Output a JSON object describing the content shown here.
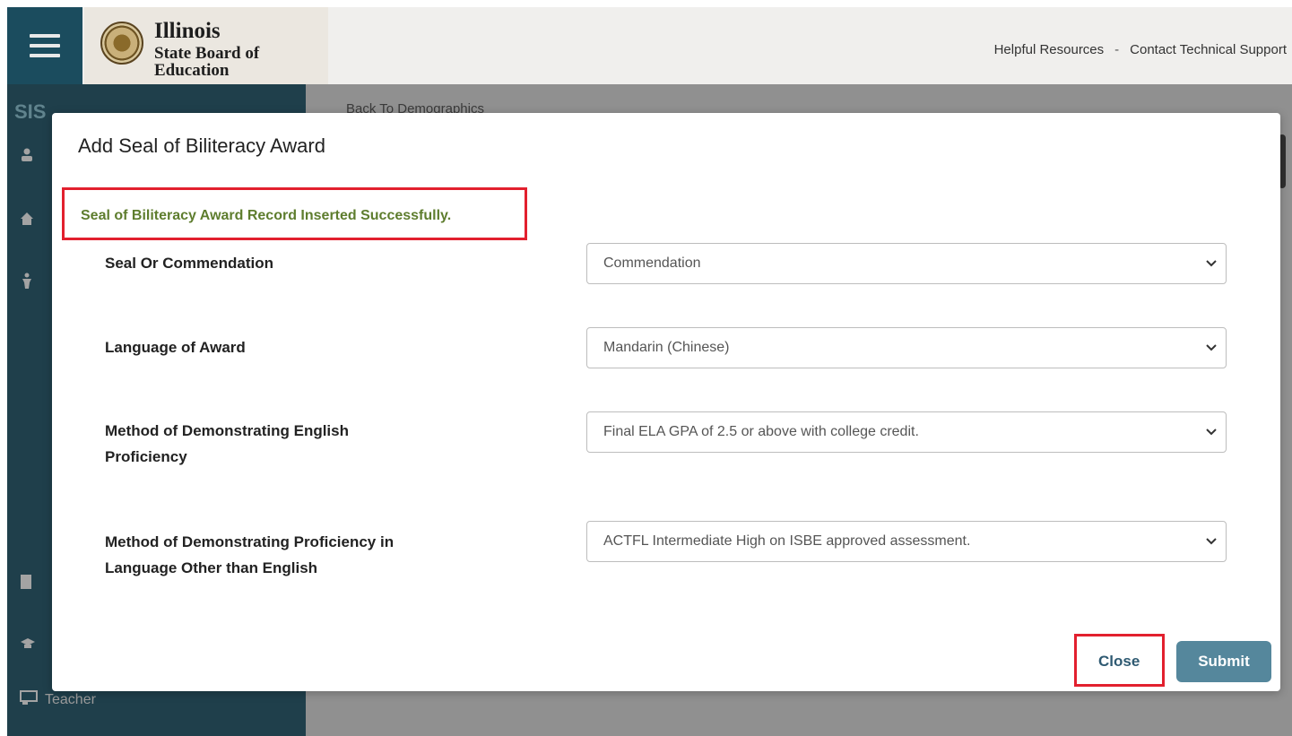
{
  "header": {
    "logo_title": "Illinois",
    "logo_subtitle": "State Board of Education",
    "links": [
      "Helpful Resources",
      "Contact Technical Support"
    ],
    "link_separator": "-"
  },
  "sidebar": {
    "section_label": "SIS",
    "teacher_label": "Teacher"
  },
  "content": {
    "back_link": "Back To Demographics"
  },
  "modal": {
    "title": "Add Seal of Biliteracy Award",
    "success_message": "Seal of Biliteracy Award Record Inserted Successfully.",
    "fields": [
      {
        "label": "Seal Or Commendation",
        "value": "Commendation"
      },
      {
        "label": "Language of Award",
        "value": "Mandarin (Chinese)"
      },
      {
        "label": "Method of Demonstrating English Proficiency",
        "value": "Final ELA GPA of 2.5 or above with college credit."
      },
      {
        "label": "Method of Demonstrating Proficiency in Language Other than English",
        "value": "ACTFL Intermediate High on ISBE approved assessment."
      }
    ],
    "close_label": "Close",
    "submit_label": "Submit"
  },
  "colors": {
    "sidebar": "#1b4c5e",
    "success_text": "#5e7d2e",
    "highlight_border": "#e2202e",
    "submit_bg": "#55879c"
  },
  "icons": [
    "menu-icon",
    "state-seal-logo",
    "user-icon",
    "home-icon",
    "student-icon",
    "document-icon",
    "graduation-cap-icon",
    "teacher-icon",
    "chevron-down-icon"
  ]
}
